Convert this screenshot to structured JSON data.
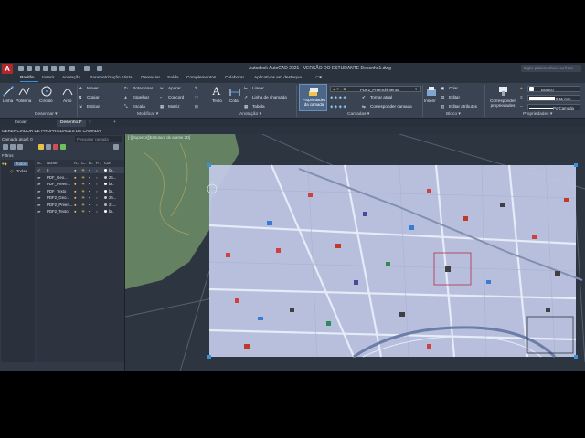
{
  "window": {
    "title": "Autodesk AutoCAD 2021 - VERSÃO DO ESTUDANTE   Desenho1.dwg",
    "search_placeholder": "Digite palavra-chave ou frase",
    "logo_letter": "A"
  },
  "menu": {
    "items": [
      "Padrão",
      "Inserir",
      "Anotação",
      "Parametrização",
      "Vista",
      "Gerenciar",
      "Saída",
      "Complementos",
      "Colaborar",
      "Aplicativos em destaque"
    ]
  },
  "ribbon": {
    "draw": {
      "buttons": [
        "Linha",
        "Polilinha",
        "Círculo",
        "Arco"
      ],
      "title": "Desenhar ▾"
    },
    "modify": {
      "buttons": [
        "Mover",
        "Rotacionar",
        "Aparar",
        "Copiar",
        "Espelhar",
        "Concord",
        "Esticar",
        "Escala",
        "Matriz"
      ],
      "title": "Modificar ▾"
    },
    "annotation": {
      "buttons": [
        "Texto",
        "Cota",
        "Linear",
        "Linha de chamada",
        "Tabela"
      ],
      "title": "Anotação ▾"
    },
    "layers": {
      "properties_button": "Propriedades da camada",
      "current_layer": "PDF2_Preenchimento",
      "buttons": [
        "Tornar atual",
        "Corresponder camada"
      ],
      "title": "Camadas ▾"
    },
    "block": {
      "insert_button": "Inserir",
      "buttons": [
        "Criar",
        "Editar",
        "Editar atributos"
      ],
      "title": "Bloco ▾"
    },
    "properties": {
      "match_button": "Corresponder propriedades",
      "color_value": "Branco",
      "lineweight_value": "0.11 mm",
      "linetype_value": "PorCamada",
      "title": "Propriedades ▾"
    }
  },
  "file_tabs": [
    "Iniciar",
    "Desenho1*"
  ],
  "layer_manager": {
    "title": "GERENCIADOR DE PROPRIEDADES DE CAMADA",
    "current_layer_label": "Camada atual: 0",
    "search_placeholder": "Pesquisar camada",
    "filters_label": "Filtros",
    "tree": [
      "Todos",
      "Todas"
    ],
    "columns": [
      "S..",
      "Nome",
      "A..",
      "C..",
      "B..",
      "P..",
      "Cor"
    ],
    "rows": [
      {
        "name": "0",
        "color_label": "br..",
        "color": "#ffffff"
      },
      {
        "name": "PDF_Geo...",
        "color_label": "25...",
        "color": "#c7c7c7"
      },
      {
        "name": "PDF_Preen...",
        "color_label": "br..",
        "color": "#ffffff"
      },
      {
        "name": "PDF_Texto",
        "color_label": "br..",
        "color": "#ffffff"
      },
      {
        "name": "PDF2_Geo...",
        "color_label": "25...",
        "color": "#c7c7c7"
      },
      {
        "name": "PDF2_Preen...",
        "color_label": "21...",
        "color": "#b5b5b5"
      },
      {
        "name": "PDF2_Texto",
        "color_label": "br..",
        "color": "#ffffff"
      }
    ]
  },
  "viewport": {
    "label": "[-][Superior][Estrutura de arame 2D]"
  },
  "colors": {
    "accent": "#3c8fd9",
    "logo_red": "#b3262b",
    "map_overlay": "#c3cbe9",
    "park_green": "#6f8f67",
    "canvas": "#2d3541"
  }
}
